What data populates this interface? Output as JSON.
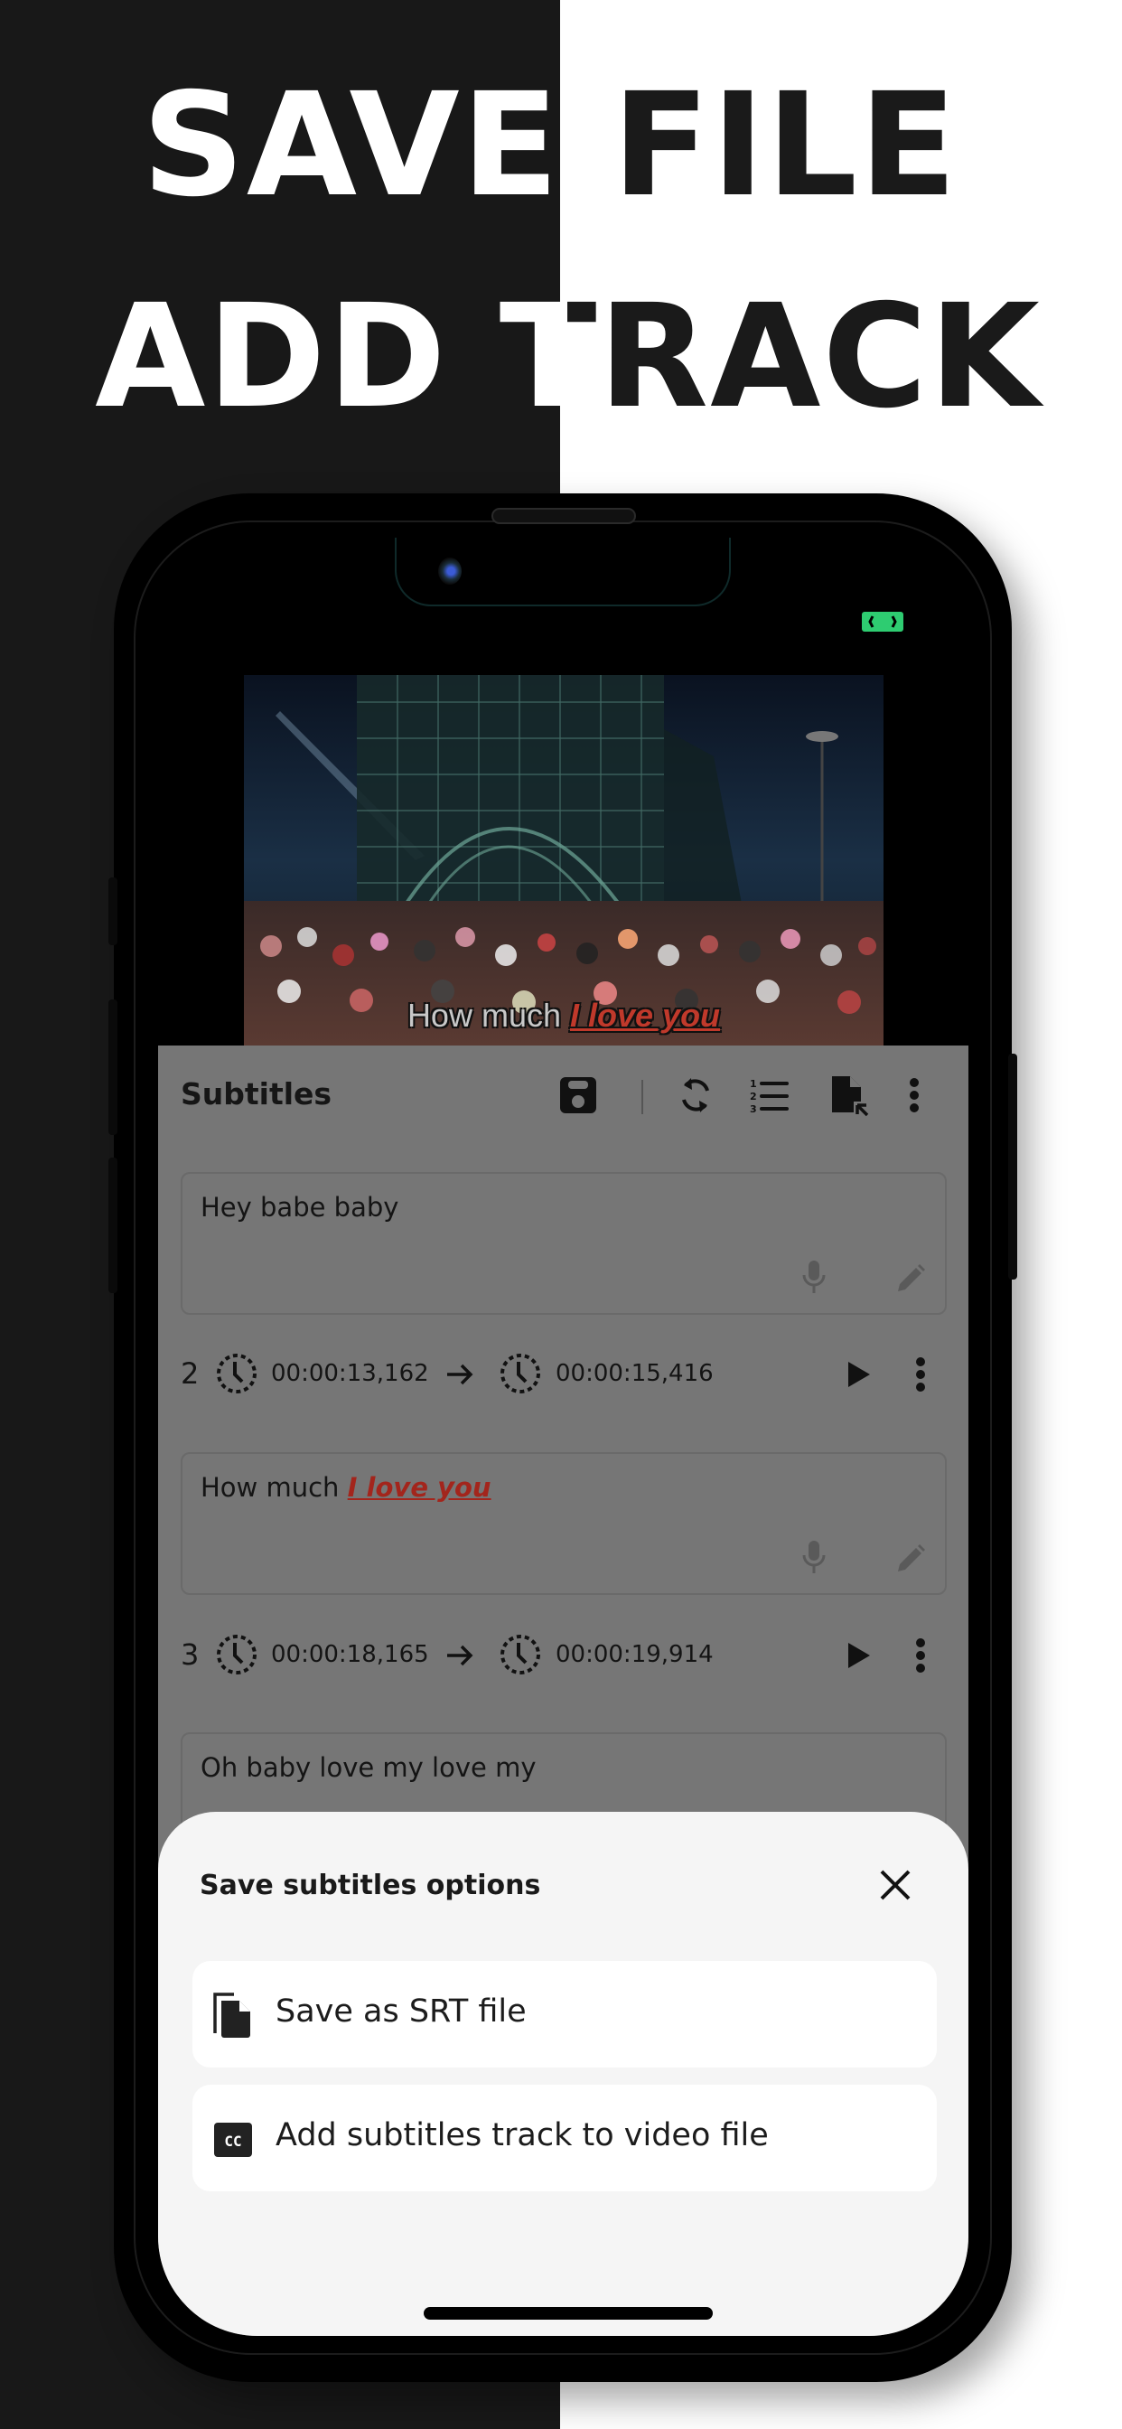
{
  "headline": {
    "line1": "SAVE FILE",
    "line2": "ADD TRACK"
  },
  "colors": {
    "dark_background": "#181818",
    "light_background": "#ffffff",
    "accent_red": "#c0392b",
    "status_green": "#2ecc71",
    "sheet_background": "#f5f5f5"
  },
  "video": {
    "caption_plain": "How much ",
    "caption_highlight": "I love you"
  },
  "subtitles_panel": {
    "title": "Subtitles",
    "toolbar_icons": [
      "save-icon",
      "sync-icon",
      "numbered-list-icon",
      "file-export-icon",
      "more-vert-icon"
    ],
    "entries": [
      {
        "index": "",
        "start": "",
        "end": "",
        "text_plain": "Hey babe baby",
        "text_highlight": ""
      },
      {
        "index": "2",
        "start": "00:00:13,162",
        "end": "00:00:15,416",
        "text_plain": "How much ",
        "text_highlight": "I love you"
      },
      {
        "index": "3",
        "start": "00:00:18,165",
        "end": "00:00:19,914",
        "text_plain": "Oh baby love my love my",
        "text_highlight": ""
      }
    ]
  },
  "sheet": {
    "title": "Save subtitles options",
    "options": [
      {
        "label": "Save as SRT file",
        "icon": "file-copy-icon"
      },
      {
        "label": "Add subtitles track to video file",
        "icon": "closed-caption-icon"
      }
    ]
  }
}
